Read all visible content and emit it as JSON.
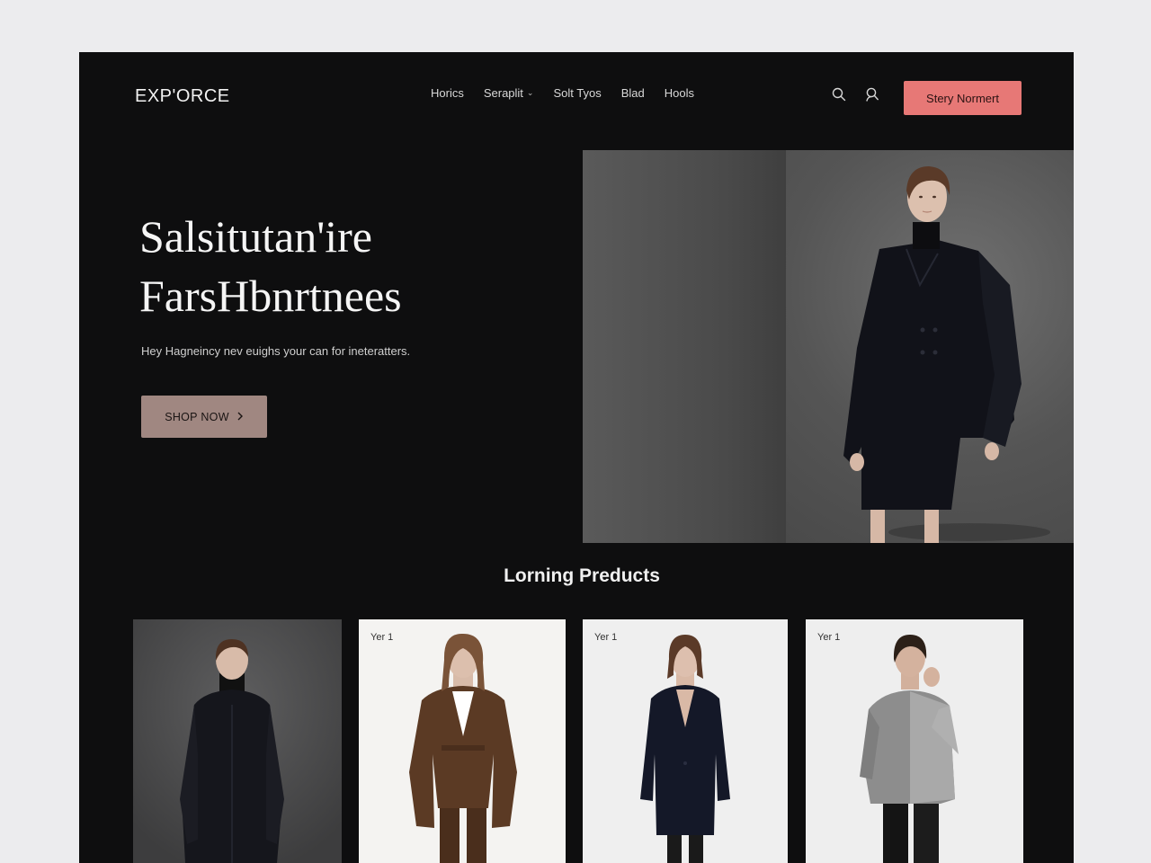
{
  "brand": {
    "logo": "EXP'ORCE"
  },
  "nav": {
    "items": [
      {
        "label": "Horics",
        "dropdown": false
      },
      {
        "label": "Seraplit",
        "dropdown": true
      },
      {
        "label": "Solt Tyos",
        "dropdown": false
      },
      {
        "label": "Blad",
        "dropdown": false
      },
      {
        "label": "Hools",
        "dropdown": false
      }
    ],
    "icons": [
      "search-icon",
      "user-search-icon"
    ],
    "cta_label": "Stery Normert"
  },
  "hero": {
    "title_line1": "Salsitutan'ire",
    "title_line2": "FarsHbnrtnees",
    "subtitle": "Hey Hagneincy nev euighs your can for ineteratters.",
    "button_label": "SHOP NOW",
    "button_icon": "chevron-right-icon"
  },
  "products": {
    "section_title": "Lorning Preducts",
    "cards": [
      {
        "tag": "",
        "background": "#4a4a4b",
        "garment": "#15161c",
        "inner": "#111"
      },
      {
        "tag": "Yer 1",
        "background": "#f4f3f1",
        "garment": "#5b3a24",
        "inner": "#ffffff"
      },
      {
        "tag": "Yer 1",
        "background": "#efefef",
        "garment": "#141828",
        "inner": "#d9b9a6"
      },
      {
        "tag": "Yer 1",
        "background": "#eeeeee",
        "garment": "#8d8d8d",
        "inner": "#3a3a3a"
      }
    ]
  },
  "colors": {
    "page_bg": "#0e0e0f",
    "cta_bg": "#e77876",
    "shop_btn_bg": "#a08781",
    "text_primary": "#f5f5f5"
  }
}
